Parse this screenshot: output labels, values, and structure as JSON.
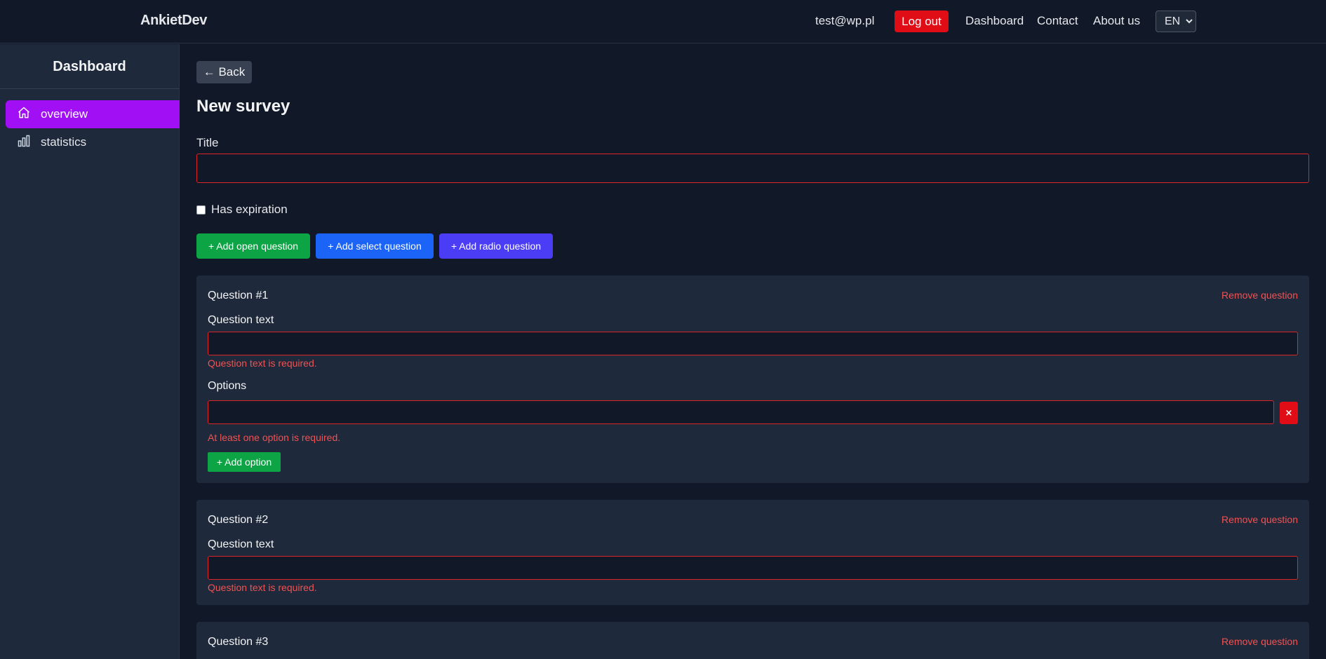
{
  "header": {
    "brand": "AnkietDev",
    "user_email": "test@wp.pl",
    "logout_label": "Log out",
    "nav": {
      "dashboard": "Dashboard",
      "contact": "Contact",
      "about": "About us"
    },
    "language": "EN"
  },
  "sidebar": {
    "title": "Dashboard",
    "items": [
      {
        "label": "overview",
        "icon": "home-icon",
        "active": true
      },
      {
        "label": "statistics",
        "icon": "bar-chart-icon",
        "active": false
      }
    ]
  },
  "main": {
    "back_label": "← Back",
    "page_title": "New survey",
    "title_label": "Title",
    "title_value": "",
    "has_expiration_label": "Has expiration",
    "has_expiration_checked": false,
    "buttons": {
      "add_open": "+ Add open question",
      "add_select": "+ Add select question",
      "add_radio": "+ Add radio question"
    },
    "questions": [
      {
        "title": "Question #1",
        "remove_label": "Remove question",
        "text_label": "Question text",
        "text_value": "",
        "text_error": "Question text is required.",
        "options_label": "Options",
        "option_values": [
          ""
        ],
        "delete_option_label": "×",
        "options_error": "At least one option is required.",
        "add_option_label": "+ Add option"
      },
      {
        "title": "Question #2",
        "remove_label": "Remove question",
        "text_label": "Question text",
        "text_value": "",
        "text_error": "Question text is required."
      },
      {
        "title": "Question #3",
        "remove_label": "Remove question"
      }
    ]
  },
  "colors": {
    "background": "#111827",
    "sidebar": "#1e293b",
    "active_item": "#a10ff5",
    "danger": "#e00d17",
    "error_text": "#f05252",
    "green": "#0ca444",
    "blue": "#1b64f7",
    "indigo": "#4b3cf5"
  }
}
